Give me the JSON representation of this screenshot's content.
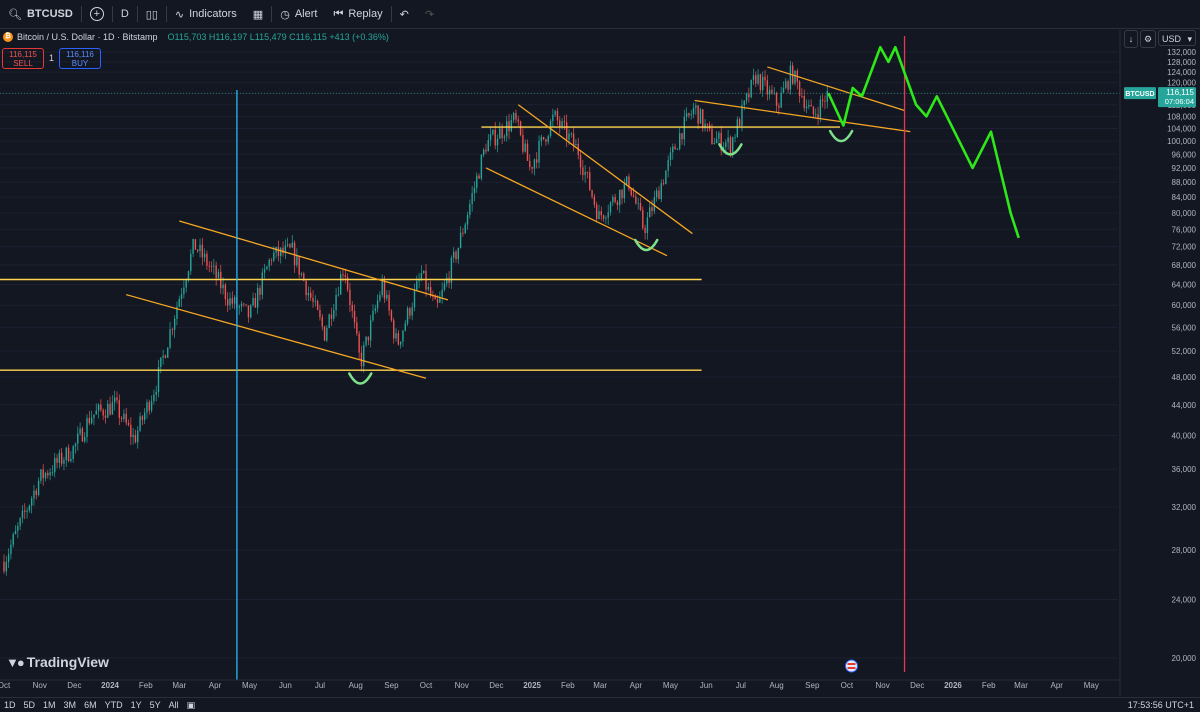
{
  "toolbar": {
    "symbol": "BTCUSD",
    "interval": "D",
    "indicators_label": "Indicators",
    "alert_label": "Alert",
    "replay_label": "Replay"
  },
  "legend": {
    "title": "Bitcoin / U.S. Dollar · 1D · Bitstamp",
    "ohlc": "O115,703 H116,197 L115,479 C116,115 +413 (+0.36%)"
  },
  "trade": {
    "sell_price": "116,115",
    "sell_label": "SELL",
    "spread": "1",
    "buy_price": "116,116",
    "buy_label": "BUY"
  },
  "currency": "USD",
  "price_tag": {
    "symbol": "BTCUSD",
    "price": "116,115",
    "countdown": "07:06:04"
  },
  "brand": "TradingView",
  "ranges": [
    "1D",
    "5D",
    "1M",
    "3M",
    "6M",
    "YTD",
    "1Y",
    "5Y",
    "All"
  ],
  "clock": "17:53:56 UTC+1",
  "colors": {
    "up": "#26a69a",
    "down": "#ef5350",
    "trend": "#f5a623",
    "support": "#ffd54f",
    "projection": "#2ee81a",
    "vline_blue": "#29b6f6",
    "vline_red": "#e53950",
    "bounce": "#7fe08a"
  },
  "chart_data": {
    "type": "candlestick",
    "title": "Bitcoin / U.S. Dollar · 1D · Bitstamp",
    "y_scale": "log",
    "ylim": [
      18500,
      140000
    ],
    "y_ticks": [
      20000,
      24000,
      28000,
      32000,
      36000,
      40000,
      44000,
      48000,
      52000,
      56000,
      60000,
      64000,
      68000,
      72000,
      76000,
      80000,
      84000,
      88000,
      92000,
      96000,
      100000,
      104000,
      108000,
      112000,
      116000,
      120000,
      124000,
      128000,
      132000
    ],
    "x_ticks": [
      "Oct",
      "Nov",
      "Dec",
      "2024",
      "Feb",
      "Mar",
      "Apr",
      "May",
      "Jun",
      "Jul",
      "Aug",
      "Sep",
      "Oct",
      "Nov",
      "Dec",
      "2025",
      "Feb",
      "Mar",
      "Apr",
      "May",
      "Jun",
      "Jul",
      "Aug",
      "Sep",
      "Oct",
      "Nov",
      "Dec",
      "2026",
      "Feb",
      "Mar",
      "Apr",
      "May"
    ],
    "price_path": [
      [
        "2023-10-01",
        27000
      ],
      [
        "2023-11-01",
        35000
      ],
      [
        "2023-12-01",
        38500
      ],
      [
        "2023-12-15",
        42500
      ],
      [
        "2024-01-05",
        44000
      ],
      [
        "2024-01-22",
        39500
      ],
      [
        "2024-02-10",
        47000
      ],
      [
        "2024-02-28",
        60000
      ],
      [
        "2024-03-14",
        72500
      ],
      [
        "2024-04-01",
        66000
      ],
      [
        "2024-04-13",
        61000
      ],
      [
        "2024-05-01",
        58000
      ],
      [
        "2024-05-20",
        70000
      ],
      [
        "2024-06-07",
        71000
      ],
      [
        "2024-07-05",
        55000
      ],
      [
        "2024-07-22",
        68000
      ],
      [
        "2024-08-05",
        50000
      ],
      [
        "2024-08-24",
        64000
      ],
      [
        "2024-09-06",
        53000
      ],
      [
        "2024-09-27",
        66000
      ],
      [
        "2024-10-10",
        59000
      ],
      [
        "2024-10-29",
        72000
      ],
      [
        "2024-11-22",
        99000
      ],
      [
        "2024-12-17",
        107000
      ],
      [
        "2024-12-30",
        92000
      ],
      [
        "2025-01-20",
        108000
      ],
      [
        "2025-02-10",
        97000
      ],
      [
        "2025-02-28",
        79000
      ],
      [
        "2025-03-26",
        88000
      ],
      [
        "2025-04-08",
        76000
      ],
      [
        "2025-05-10",
        103000
      ],
      [
        "2025-05-22",
        111000
      ],
      [
        "2025-06-05",
        101000
      ],
      [
        "2025-06-22",
        99000
      ],
      [
        "2025-07-14",
        122500
      ],
      [
        "2025-08-02",
        112000
      ],
      [
        "2025-08-14",
        124000
      ],
      [
        "2025-09-01",
        108000
      ],
      [
        "2025-09-15",
        116115
      ]
    ],
    "annotations": {
      "horizontal_levels": [
        49000,
        65000,
        104500
      ],
      "projection": [
        [
          "2025-09-15",
          116115
        ],
        [
          "2025-09-28",
          105000
        ],
        [
          "2025-10-06",
          118000
        ],
        [
          "2025-10-14",
          115000
        ],
        [
          "2025-10-30",
          134000
        ],
        [
          "2025-11-06",
          128000
        ],
        [
          "2025-11-12",
          134000
        ],
        [
          "2025-11-30",
          112000
        ],
        [
          "2025-12-09",
          108000
        ],
        [
          "2025-12-18",
          115000
        ],
        [
          "2026-01-18",
          92000
        ],
        [
          "2026-02-03",
          103000
        ],
        [
          "2026-02-20",
          80000
        ],
        [
          "2026-02-27",
          74000
        ]
      ],
      "vertical_lines": [
        "2024-04-20",
        "2025-11-20"
      ]
    }
  }
}
